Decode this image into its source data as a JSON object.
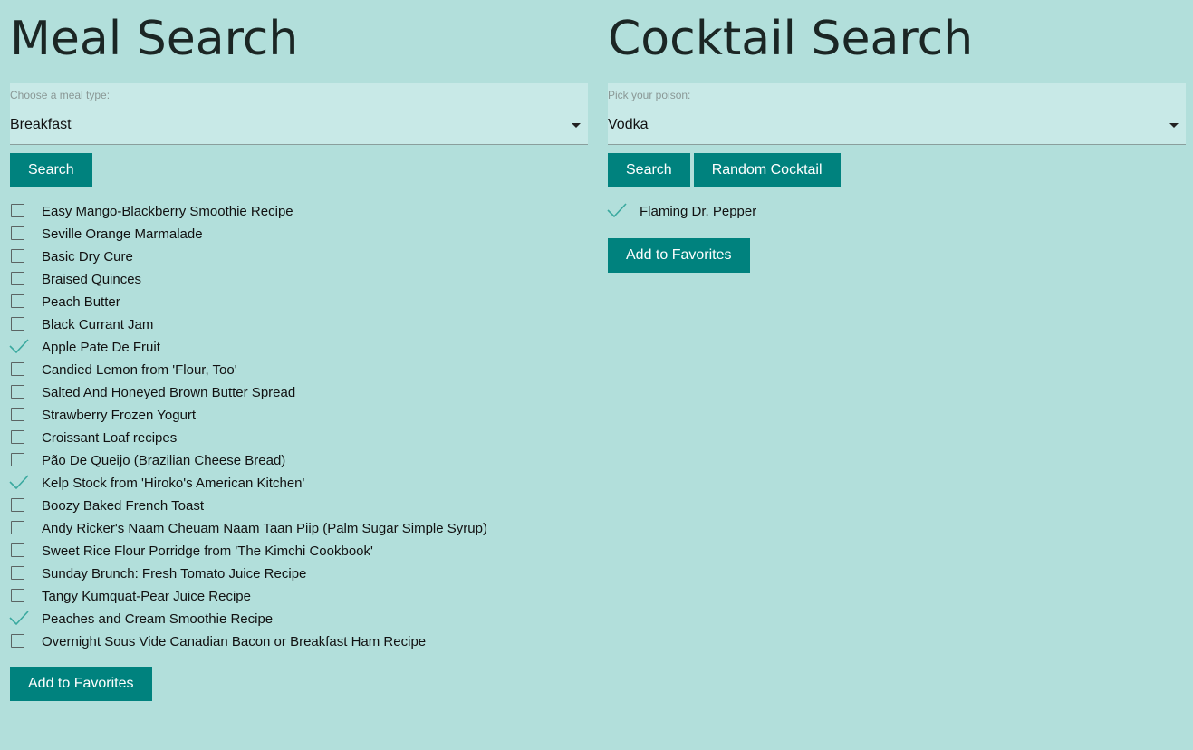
{
  "meal": {
    "title": "Meal Search",
    "select_label": "Choose a meal type:",
    "select_value": "Breakfast",
    "search_label": "Search",
    "items": [
      {
        "label": "Easy Mango-Blackberry Smoothie Recipe",
        "checked": false
      },
      {
        "label": "Seville Orange Marmalade",
        "checked": false
      },
      {
        "label": "Basic Dry Cure",
        "checked": false
      },
      {
        "label": "Braised Quinces",
        "checked": false
      },
      {
        "label": "Peach Butter",
        "checked": false
      },
      {
        "label": "Black Currant Jam",
        "checked": false
      },
      {
        "label": "Apple Pate De Fruit",
        "checked": true
      },
      {
        "label": "Candied Lemon from 'Flour, Too'",
        "checked": false
      },
      {
        "label": "Salted And Honeyed Brown Butter Spread",
        "checked": false
      },
      {
        "label": "Strawberry Frozen Yogurt",
        "checked": false
      },
      {
        "label": "Croissant Loaf recipes",
        "checked": false
      },
      {
        "label": "Pão De Queijo (Brazilian Cheese Bread)",
        "checked": false
      },
      {
        "label": "Kelp Stock from 'Hiroko's American Kitchen'",
        "checked": true
      },
      {
        "label": "Boozy Baked French Toast",
        "checked": false
      },
      {
        "label": "Andy Ricker's Naam Cheuam Naam Taan Piip (Palm Sugar Simple Syrup)",
        "checked": false
      },
      {
        "label": "Sweet Rice Flour Porridge from 'The Kimchi Cookbook'",
        "checked": false
      },
      {
        "label": "Sunday Brunch: Fresh Tomato Juice Recipe",
        "checked": false
      },
      {
        "label": "Tangy Kumquat-Pear Juice Recipe",
        "checked": false
      },
      {
        "label": "Peaches and Cream Smoothie Recipe",
        "checked": true
      },
      {
        "label": "Overnight Sous Vide Canadian Bacon or Breakfast Ham Recipe",
        "checked": false
      }
    ],
    "favorites_label": "Add to Favorites"
  },
  "cocktail": {
    "title": "Cocktail Search",
    "select_label": "Pick your poison:",
    "select_value": "Vodka",
    "search_label": "Search",
    "random_label": "Random Cocktail",
    "items": [
      {
        "label": "Flaming Dr. Pepper",
        "checked": true
      }
    ],
    "favorites_label": "Add to Favorites"
  },
  "colors": {
    "background": "#b2dfdb",
    "button": "#00827e",
    "select_bg": "#c8e9e7",
    "check": "#3aa99f"
  },
  "icons": {
    "checked": "checkmark-icon",
    "unchecked": "checkbox-icon",
    "dropdown": "caret-down-icon"
  }
}
